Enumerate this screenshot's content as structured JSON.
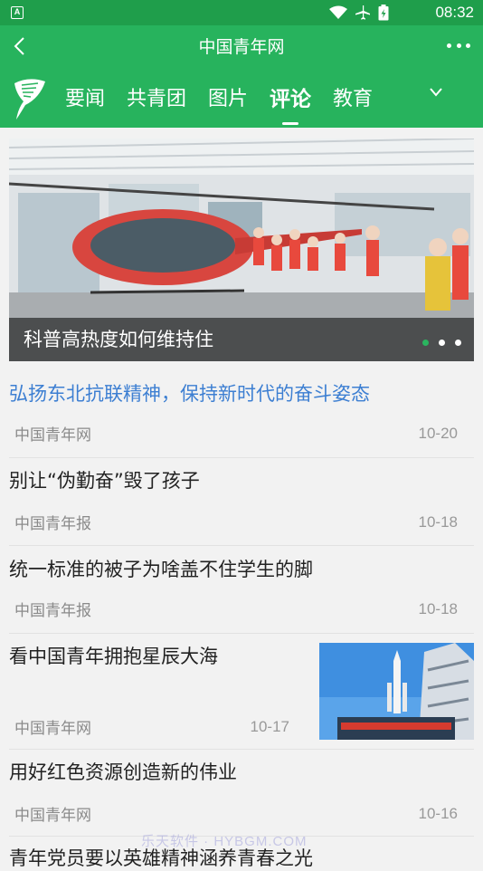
{
  "status_bar": {
    "time": "08:32",
    "app_badge": "A"
  },
  "header": {
    "title": "中国青年网"
  },
  "tabs": [
    {
      "label": "要闻",
      "active": false
    },
    {
      "label": "共青团",
      "active": false
    },
    {
      "label": "图片",
      "active": false
    },
    {
      "label": "评论",
      "active": true
    },
    {
      "label": "教育",
      "active": false
    }
  ],
  "carousel": {
    "caption": "科普高热度如何维持住",
    "slide_count": 3,
    "active_slide": 1
  },
  "news": [
    {
      "title": "弘扬东北抗联精神，保持新时代的奋斗姿态",
      "source": "中国青年网",
      "date": "10-20",
      "highlight": true
    },
    {
      "title": "别让“伪勤奋”毁了孩子",
      "source": "中国青年报",
      "date": "10-18"
    },
    {
      "title": "统一标准的被子为啥盖不住学生的脚",
      "source": "中国青年报",
      "date": "10-18"
    },
    {
      "title": "看中国青年拥抱星辰大海",
      "source": "中国青年网",
      "date": "10-17",
      "has_thumbnail": true
    },
    {
      "title": "用好红色资源创造新的伟业",
      "source": "中国青年网",
      "date": "10-16"
    },
    {
      "title": "青年党员要以英雄精神涵养青春之光"
    }
  ],
  "watermark": "乐天软件 · HYBGM.COM",
  "colors": {
    "brand_green": "#27b35d",
    "status_green": "#1f9e4b",
    "link_blue": "#3d7fd2"
  }
}
